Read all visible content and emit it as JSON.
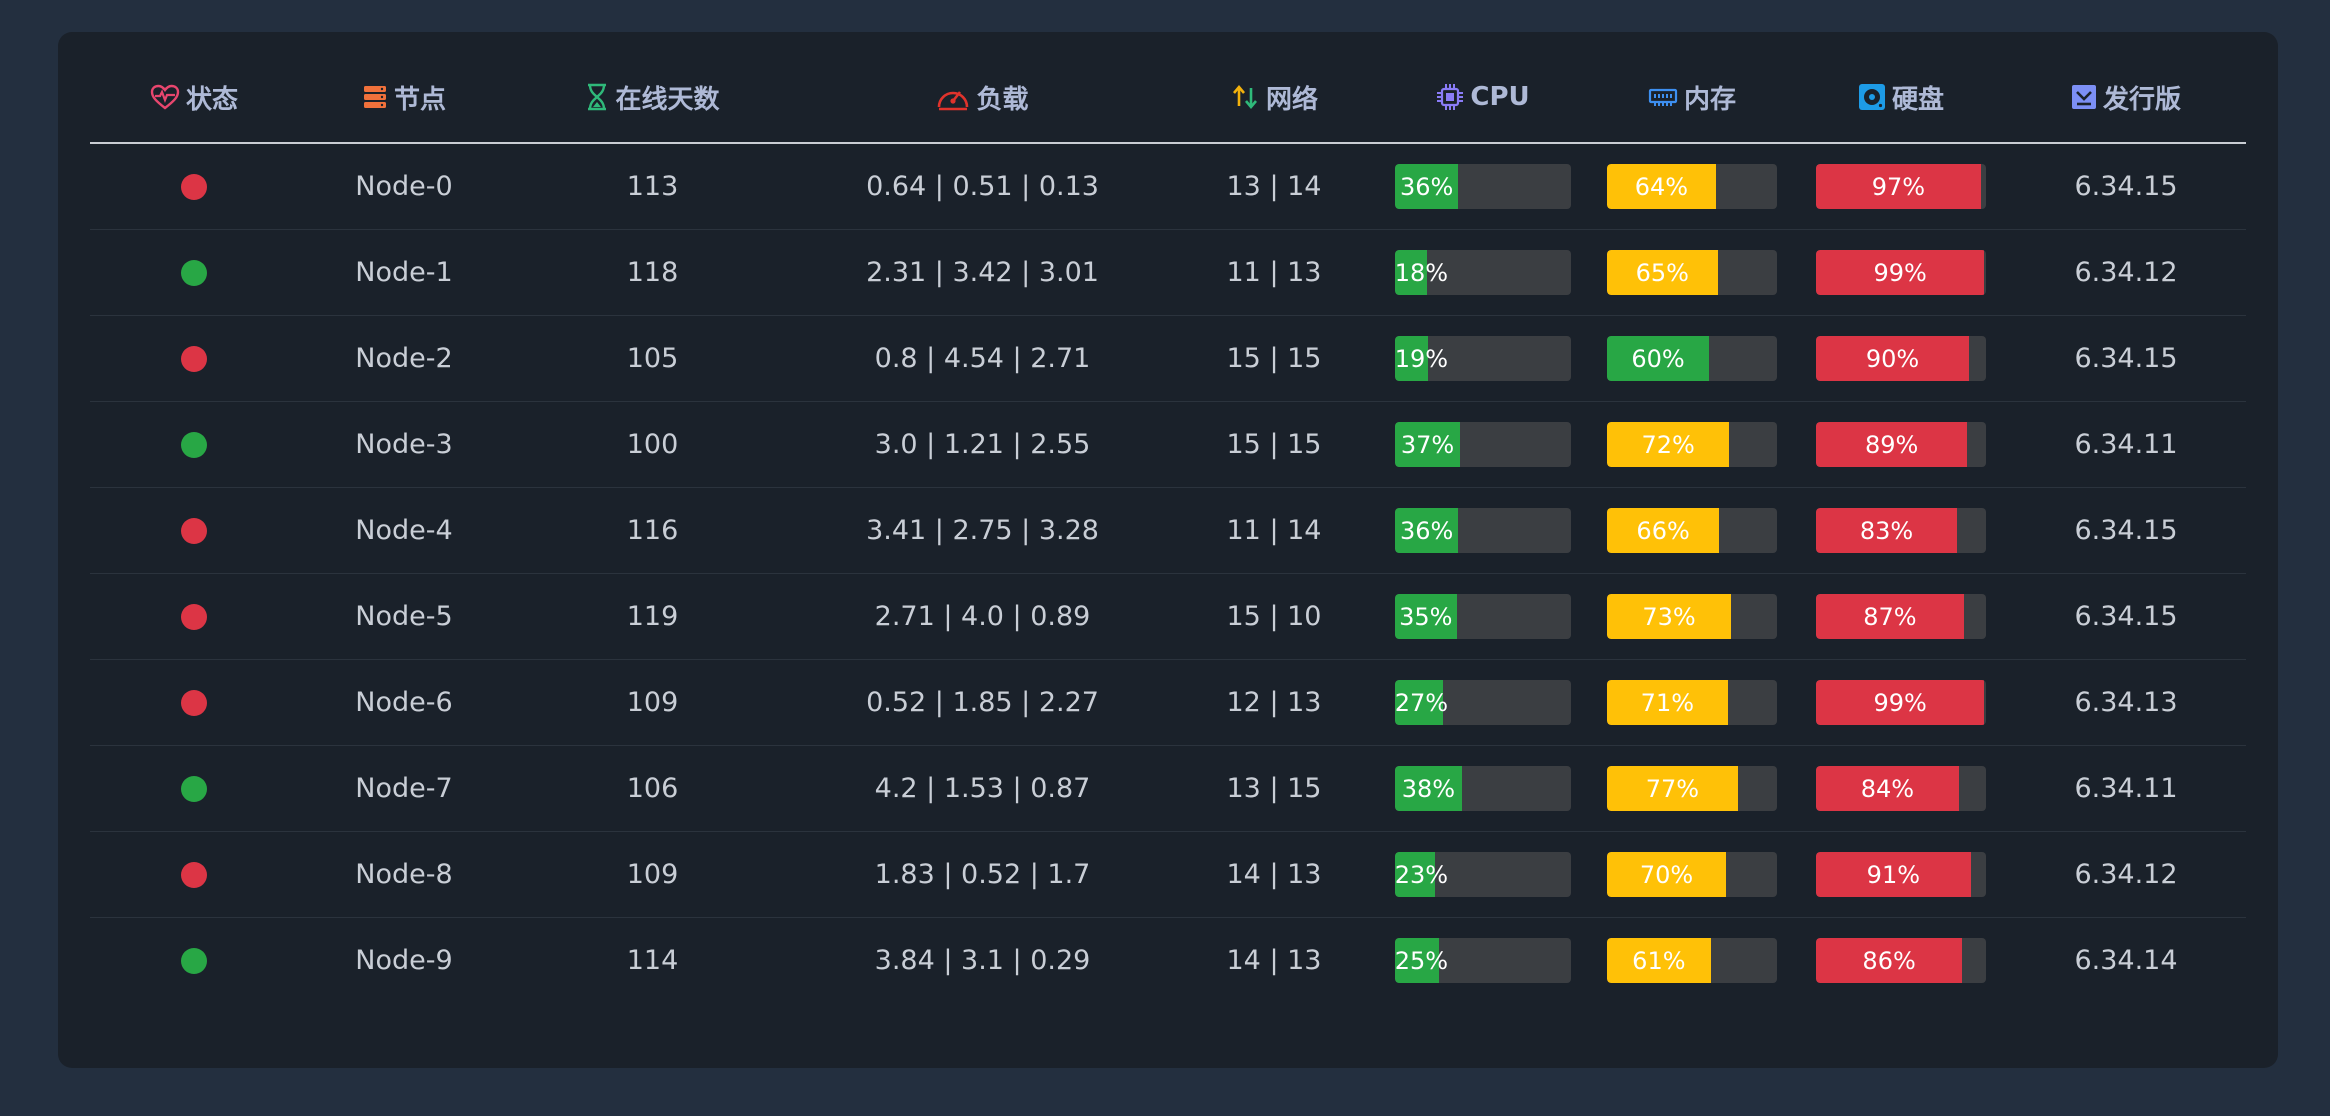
{
  "colors": {
    "online": "#28a745",
    "offline": "#dc3545",
    "cpu_fill": "#28a745",
    "mem_ok": "#28a745",
    "mem_warn": "#ffc107",
    "disk_fill": "#dc3545"
  },
  "headers": {
    "status": {
      "label": "状态",
      "icon": "heart-pulse-icon"
    },
    "node": {
      "label": "节点",
      "icon": "server-icon"
    },
    "days": {
      "label": "在线天数",
      "icon": "hourglass-icon"
    },
    "load": {
      "label": "负载",
      "icon": "speedometer-icon"
    },
    "network": {
      "label": "网络",
      "icon": "up-down-arrows-icon"
    },
    "cpu": {
      "label": "CPU",
      "icon": "cpu-chip-icon"
    },
    "memory": {
      "label": "内存",
      "icon": "memory-icon"
    },
    "disk": {
      "label": "硬盘",
      "icon": "hard-disk-icon"
    },
    "version": {
      "label": "发行版",
      "icon": "download-box-icon"
    }
  },
  "rows": [
    {
      "status": "offline",
      "node": "Node-0",
      "days": "113",
      "load": "0.64 | 0.51 | 0.13",
      "network": "13 | 14",
      "cpu": 36,
      "cpu_label": "36%",
      "mem": 64,
      "mem_label": "64%",
      "disk": 97,
      "disk_label": "97%",
      "version": "6.34.15"
    },
    {
      "status": "online",
      "node": "Node-1",
      "days": "118",
      "load": "2.31 | 3.42 | 3.01",
      "network": "11 | 13",
      "cpu": 18,
      "cpu_label": "18%",
      "mem": 65,
      "mem_label": "65%",
      "disk": 99,
      "disk_label": "99%",
      "version": "6.34.12"
    },
    {
      "status": "offline",
      "node": "Node-2",
      "days": "105",
      "load": "0.8 | 4.54 | 2.71",
      "network": "15 | 15",
      "cpu": 19,
      "cpu_label": "19%",
      "mem": 60,
      "mem_label": "60%",
      "disk": 90,
      "disk_label": "90%",
      "version": "6.34.15"
    },
    {
      "status": "online",
      "node": "Node-3",
      "days": "100",
      "load": "3.0 | 1.21 | 2.55",
      "network": "15 | 15",
      "cpu": 37,
      "cpu_label": "37%",
      "mem": 72,
      "mem_label": "72%",
      "disk": 89,
      "disk_label": "89%",
      "version": "6.34.11"
    },
    {
      "status": "offline",
      "node": "Node-4",
      "days": "116",
      "load": "3.41 | 2.75 | 3.28",
      "network": "11 | 14",
      "cpu": 36,
      "cpu_label": "36%",
      "mem": 66,
      "mem_label": "66%",
      "disk": 83,
      "disk_label": "83%",
      "version": "6.34.15"
    },
    {
      "status": "offline",
      "node": "Node-5",
      "days": "119",
      "load": "2.71 | 4.0 | 0.89",
      "network": "15 | 10",
      "cpu": 35,
      "cpu_label": "35%",
      "mem": 73,
      "mem_label": "73%",
      "disk": 87,
      "disk_label": "87%",
      "version": "6.34.15"
    },
    {
      "status": "offline",
      "node": "Node-6",
      "days": "109",
      "load": "0.52 | 1.85 | 2.27",
      "network": "12 | 13",
      "cpu": 27,
      "cpu_label": "27%",
      "mem": 71,
      "mem_label": "71%",
      "disk": 99,
      "disk_label": "99%",
      "version": "6.34.13"
    },
    {
      "status": "online",
      "node": "Node-7",
      "days": "106",
      "load": "4.2 | 1.53 | 0.87",
      "network": "13 | 15",
      "cpu": 38,
      "cpu_label": "38%",
      "mem": 77,
      "mem_label": "77%",
      "disk": 84,
      "disk_label": "84%",
      "version": "6.34.11"
    },
    {
      "status": "offline",
      "node": "Node-8",
      "days": "109",
      "load": "1.83 | 0.52 | 1.7",
      "network": "14 | 13",
      "cpu": 23,
      "cpu_label": "23%",
      "mem": 70,
      "mem_label": "70%",
      "disk": 91,
      "disk_label": "91%",
      "version": "6.34.12"
    },
    {
      "status": "online",
      "node": "Node-9",
      "days": "114",
      "load": "3.84 | 3.1 | 0.29",
      "network": "14 | 13",
      "cpu": 25,
      "cpu_label": "25%",
      "mem": 61,
      "mem_label": "61%",
      "disk": 86,
      "disk_label": "86%",
      "version": "6.34.14"
    }
  ]
}
